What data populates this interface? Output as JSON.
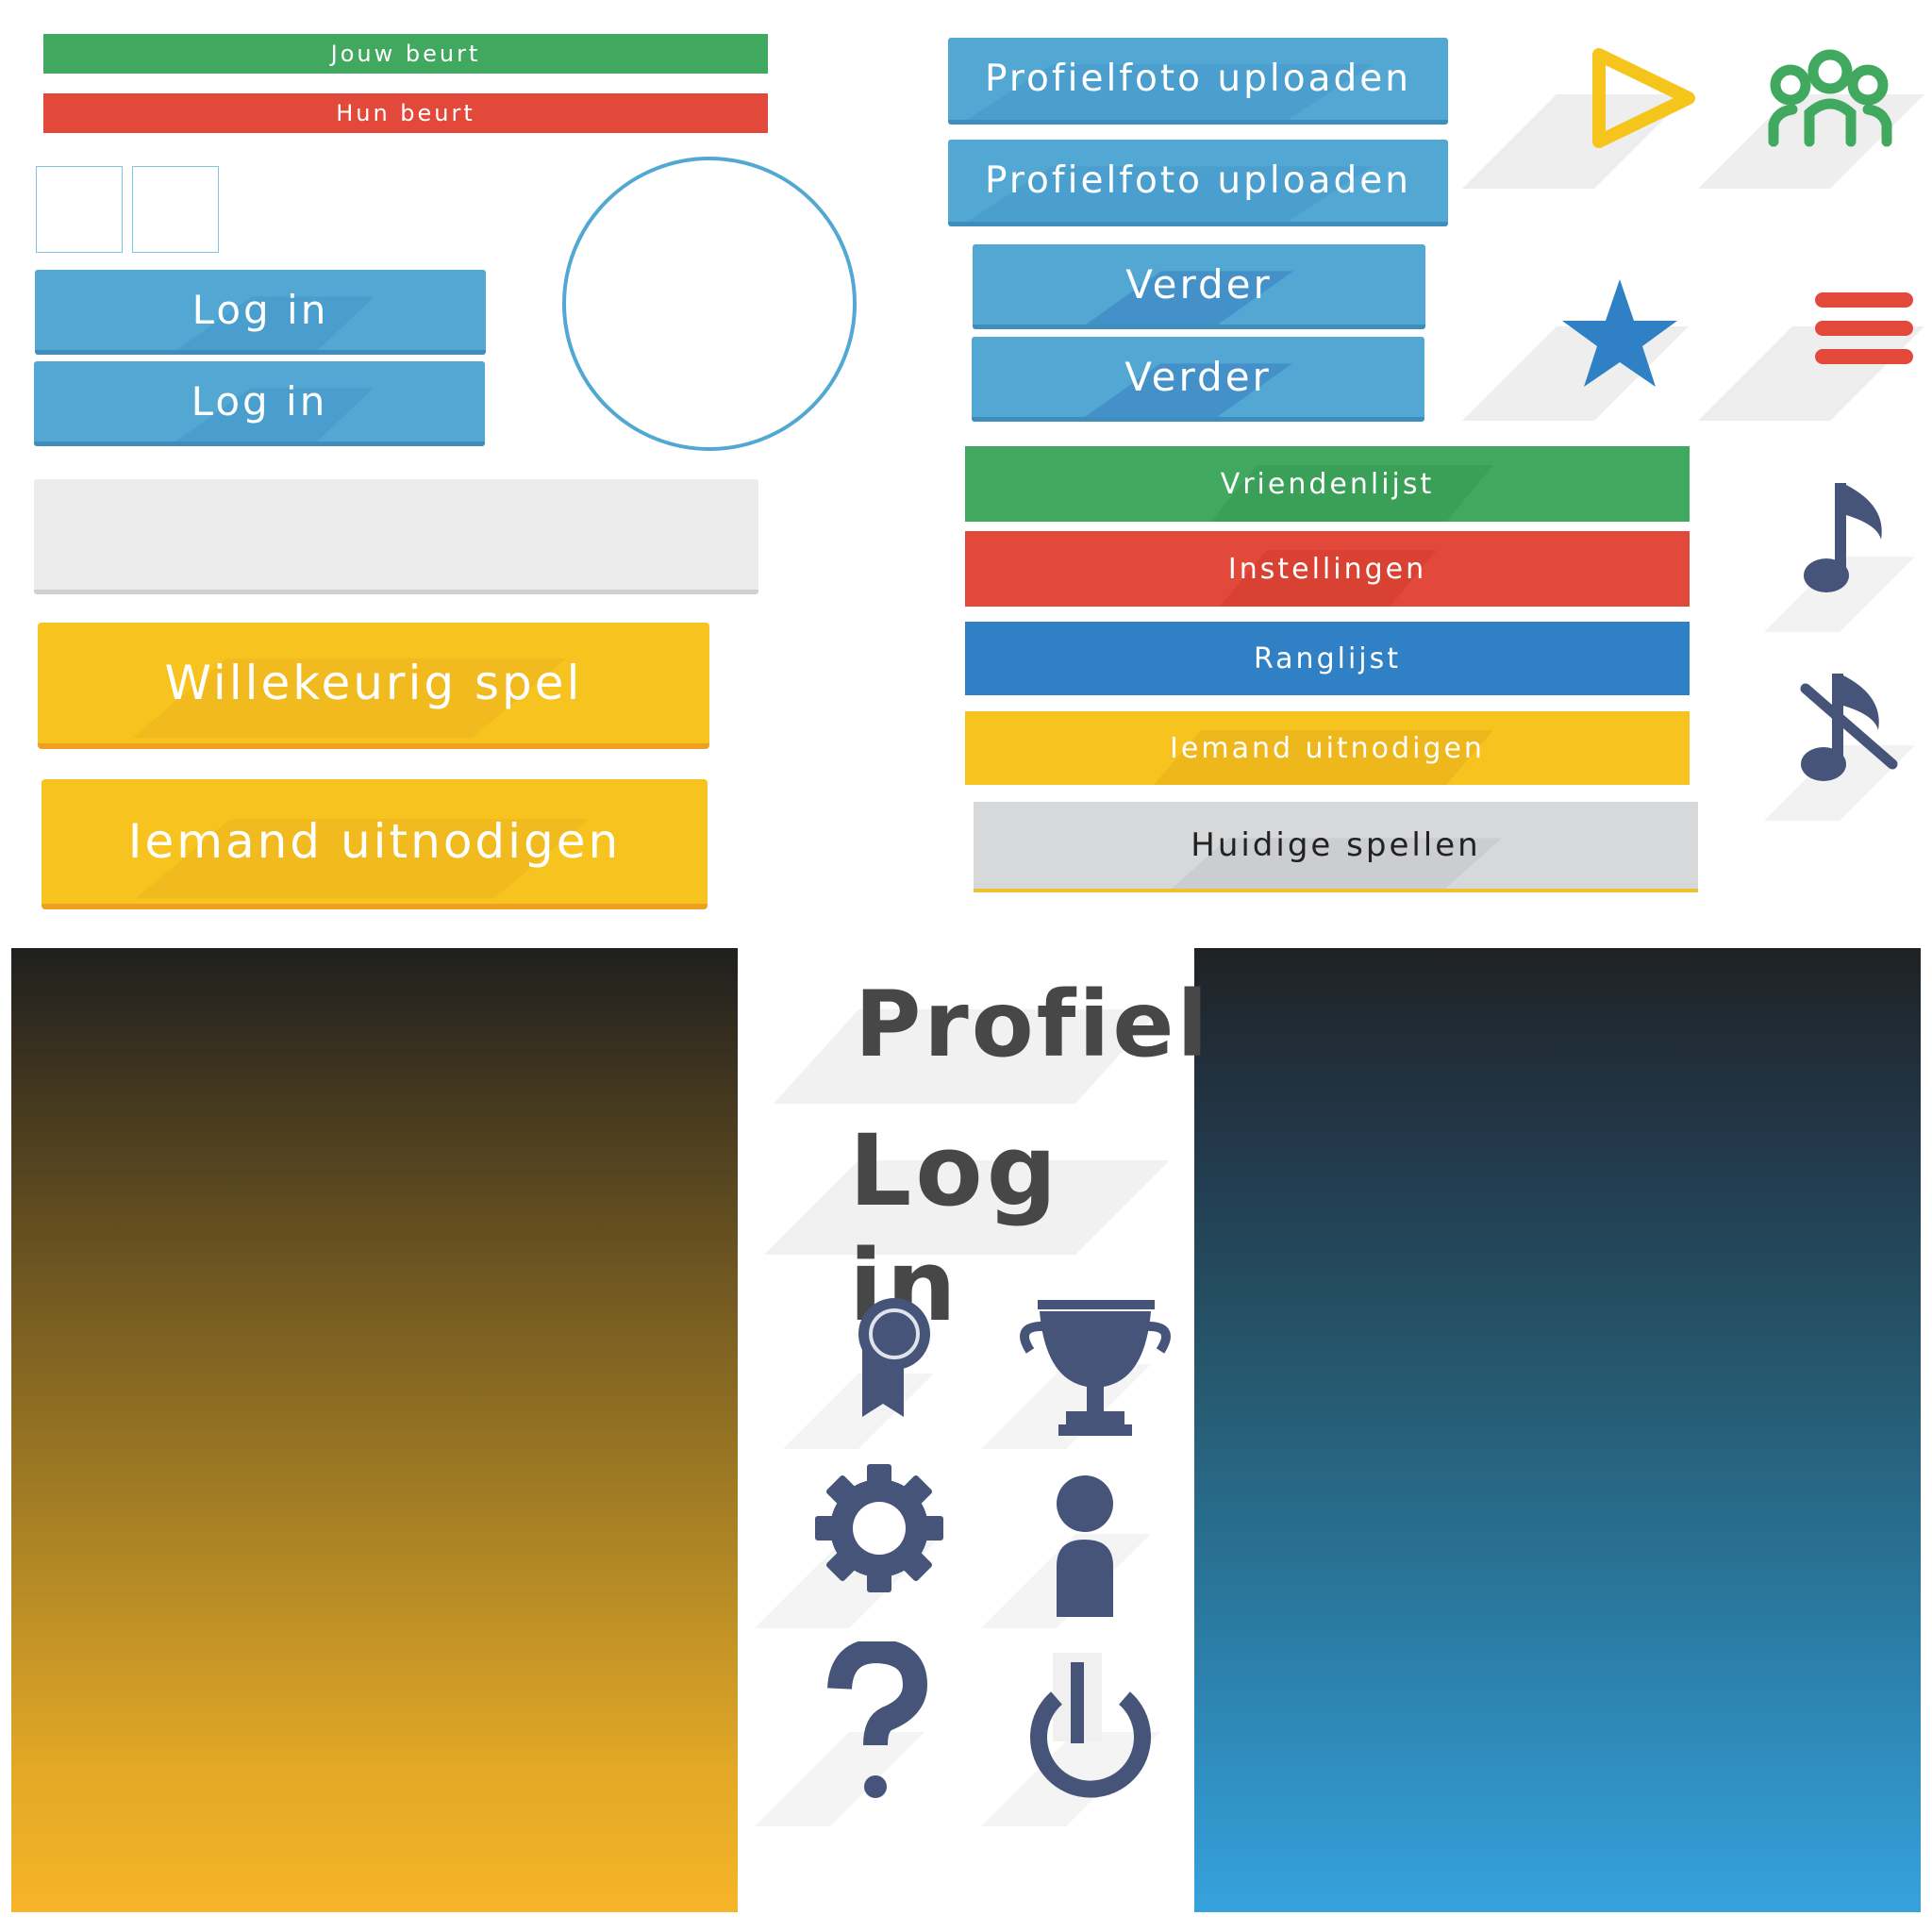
{
  "turns": {
    "your_turn": "Jouw beurt",
    "their_turn": "Hun beurt"
  },
  "login_buttons": [
    "Log in",
    "Log in"
  ],
  "profile_upload": [
    "Profielfoto uploaden",
    "Profielfoto uploaden"
  ],
  "next_buttons": [
    "Verder",
    "Verder"
  ],
  "menu": {
    "friends": "Vriendenlijst",
    "settings": "Instellingen",
    "ranking": "Ranglijst",
    "invite": "Iemand uitnodigen",
    "current_games": "Huidige spellen"
  },
  "big_buttons": {
    "random_game": "Willekeurig spel",
    "invite": "Iemand uitnodigen"
  },
  "headings": {
    "profile": "Profiel",
    "login": "Log in"
  },
  "colors": {
    "green": "#41a95f",
    "red": "#e2493a",
    "blue": "#52a8d3",
    "dark_blue": "#2f80c4",
    "yellow": "#f7c31e",
    "gray": "#d6d8da",
    "icon": "#46547a"
  },
  "icons": [
    "play-icon",
    "group-icon",
    "star-icon",
    "menu-icon",
    "music-note-icon",
    "music-off-icon",
    "ribbon-medal-icon",
    "trophy-icon",
    "gear-icon",
    "user-icon",
    "help-icon",
    "power-icon"
  ]
}
